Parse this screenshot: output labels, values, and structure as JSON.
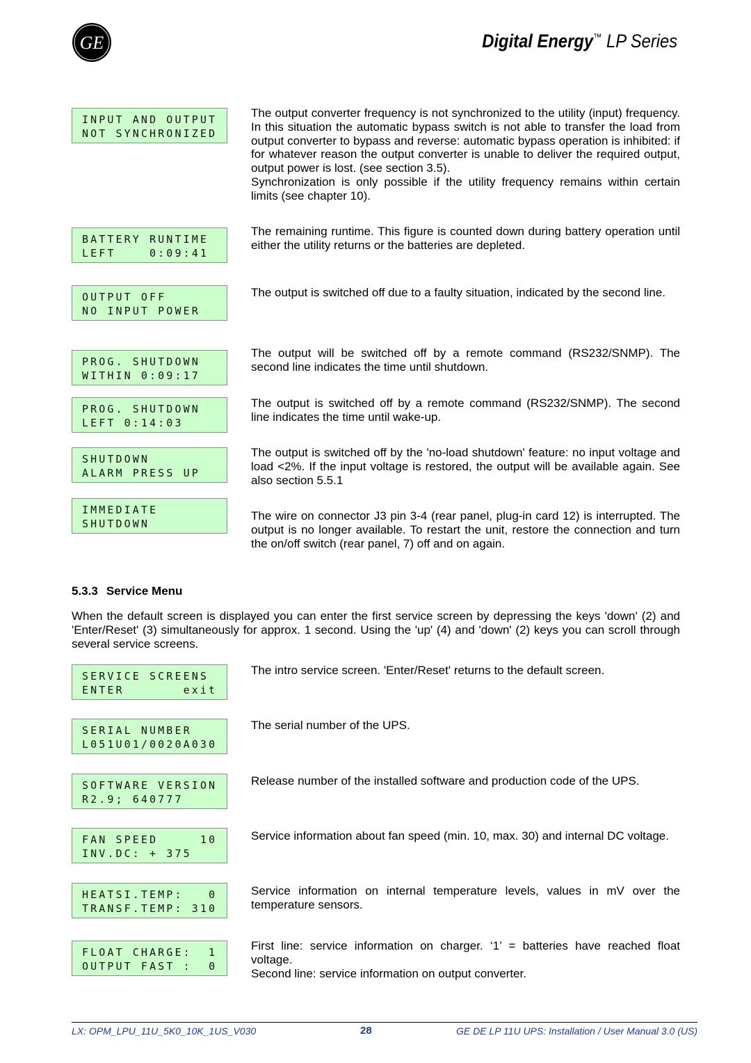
{
  "header": {
    "brand_bold": "Digital Energy",
    "brand_tm": "™",
    "brand_rest": " LP Series",
    "logo_text": "GE"
  },
  "rows1": [
    {
      "lcd": [
        "INPUT AND OUTPUT",
        "NOT SYNCHRONIZED"
      ],
      "desc": [
        "The output converter frequency is not synchronized to the utility (input) frequency. In this situation the automatic bypass switch is not able to transfer the load from output converter to bypass and reverse: automatic bypass operation is inhibited: if for whatever reason the output converter is unable to deliver the required output, output power is lost. (see section 3.5).",
        "Synchronization is only possible if the utility frequency remains within certain limits (see chapter 10)."
      ]
    },
    {
      "lcd": [
        "BATTERY RUNTIME",
        "LEFT    0:09:41"
      ],
      "desc": [
        "The remaining runtime. This figure is counted down during battery operation until either the utility returns or the batteries are depleted."
      ]
    },
    {
      "lcd": [
        "OUTPUT OFF",
        "NO INPUT POWER"
      ],
      "desc": [
        "The output is switched off due to a faulty situation, indicated by the second line."
      ]
    },
    {
      "lcd": [
        "PROG. SHUTDOWN",
        "WITHIN 0:09:17"
      ],
      "desc": [
        "The output will be switched off by a remote command (RS232/SNMP). The second line indicates the time until shutdown."
      ]
    },
    {
      "lcd": [
        "PROG. SHUTDOWN",
        "LEFT 0:14:03"
      ],
      "desc": [
        "The output is switched off by a remote command (RS232/SNMP). The second line indicates the time until wake-up."
      ]
    },
    {
      "lcd": [
        "SHUTDOWN",
        "ALARM PRESS UP"
      ],
      "desc": [
        "The output is switched off by the 'no-load shutdown' feature: no input voltage and  load <2%. If the input voltage is restored, the output will be available again. See also section 5.5.1"
      ]
    },
    {
      "lcd": [
        "IMMEDIATE",
        "SHUTDOWN"
      ],
      "desc": [
        "The wire on connector J3 pin 3-4 (rear panel, plug-in card 12) is interrupted. The output is no longer available. To restart the unit, restore the connection and turn the on/off switch (rear panel, 7) off and on again."
      ]
    }
  ],
  "section": {
    "number": "5.3.3",
    "title": "Service Menu",
    "intro": "When the default screen is displayed you can enter the first service screen by depressing the keys 'down' (2) and 'Enter/Reset' (3) simultaneously for approx. 1 second. Using the 'up' (4) and 'down' (2) keys you can scroll through several service screens."
  },
  "rows2": [
    {
      "lcd": [
        "SERVICE SCREENS",
        "ENTER       exit"
      ],
      "desc": [
        "The intro service screen. 'Enter/Reset' returns to the default screen."
      ]
    },
    {
      "lcd": [
        "SERIAL NUMBER",
        "L051U01/0020A030"
      ],
      "desc": [
        "The serial number of the UPS."
      ]
    },
    {
      "lcd": [
        "SOFTWARE VERSION",
        "R2.9; 640777"
      ],
      "desc": [
        "Release number of the installed software and production code of the UPS."
      ]
    },
    {
      "lcd": [
        "FAN SPEED     10",
        "INV.DC: + 375"
      ],
      "desc": [
        "Service information about fan speed (min. 10, max. 30) and internal DC voltage."
      ]
    },
    {
      "lcd": [
        "HEATSI.TEMP:   0",
        "TRANSF.TEMP: 310"
      ],
      "desc": [
        "Service information on internal temperature levels, values in mV over the temperature sensors."
      ]
    },
    {
      "lcd": [
        "FLOAT CHARGE:  1",
        "OUTPUT FAST :  0"
      ],
      "desc": [
        "First line: service information on charger. ‘1’ = batteries have reached float voltage.",
        "Second line: service information on output converter."
      ]
    }
  ],
  "footer": {
    "left": "LX: OPM_LPU_11U_5K0_10K_1US_V030",
    "page": "28",
    "right": "GE DE LP 11U UPS: Installation / User Manual 3.0 (US)"
  },
  "colors": {
    "lcd_bg": "#ccffcc",
    "footer": "#1f3a9a"
  }
}
